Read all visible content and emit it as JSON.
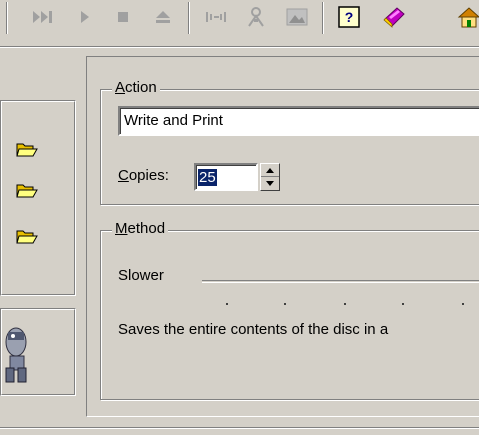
{
  "toolbar": {
    "items": [
      {
        "icon": "skip-forward-icon"
      },
      {
        "icon": "play-icon"
      },
      {
        "icon": "stop-icon"
      },
      {
        "icon": "eject-icon"
      },
      {
        "icon": "tracks-icon"
      },
      {
        "icon": "tools-icon"
      },
      {
        "icon": "image-icon"
      },
      {
        "icon": "help-icon",
        "glyph": "?"
      },
      {
        "icon": "book-icon"
      },
      {
        "icon": "home-icon"
      }
    ]
  },
  "action": {
    "legend_prefix": "",
    "legend_accel": "A",
    "legend_rest": "ction",
    "value": "Write and Print",
    "copies_accel": "C",
    "copies_rest": "opies:",
    "copies_value": "25"
  },
  "method": {
    "legend_accel": "M",
    "legend_rest": "ethod",
    "slider_label": "Slower",
    "description": "Saves the entire contents of the disc in a"
  }
}
